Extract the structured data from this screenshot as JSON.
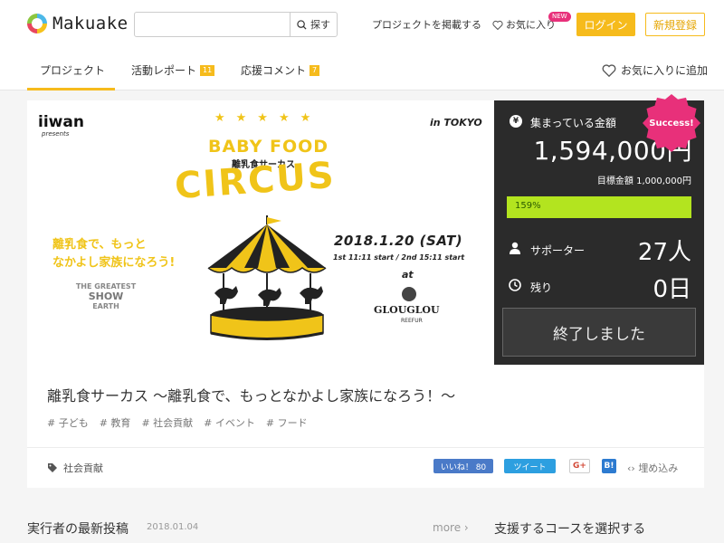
{
  "header": {
    "logo": "Makuake",
    "search_placeholder": "",
    "search_button": "探す",
    "post_project": "プロジェクトを掲載する",
    "favorites": "お気に入り",
    "new_badge": "NEW",
    "login": "ログイン",
    "signup": "新規登録"
  },
  "tabs": [
    {
      "label": "プロジェクト"
    },
    {
      "label": "活動レポート",
      "count": "11"
    },
    {
      "label": "応援コメント",
      "count": "7"
    }
  ],
  "add_favorite": "お気に入りに追加",
  "hero": {
    "brand": "iiwan",
    "brand_sub": "presents",
    "city": "in TOKYO",
    "stars": "★★★★★",
    "baby_food": "BABY FOOD",
    "baby_food_sub": "離乳食サーカス",
    "circus": "CIRCUS",
    "catch_line1": "離乳食で、もっと",
    "catch_line2": "なかよし家族になろう!",
    "greatest_1": "THE GREATEST",
    "greatest_2": "SHOW",
    "greatest_3": "EARTH",
    "date": "2018.1.20 (SAT)",
    "times": "1st 11:11 start / 2nd 15:11 start",
    "at": "at",
    "venue": "GLOUGLOU",
    "venue_sub": "REEFUR"
  },
  "funding": {
    "collected_label": "集まっている金額",
    "amount": "1,594,000円",
    "goal": "目標金額 1,000,000円",
    "progress_text": "159%",
    "progress_fraction": 1.0,
    "supporters_label": "サポーター",
    "supporters_value": "27人",
    "remaining_label": "残り",
    "remaining_value": "0日",
    "finished": "終了しました",
    "success_badge": "Success!"
  },
  "project": {
    "title": "離乳食サーカス ～離乳食で、もっとなかよし家族になろう！～",
    "tags": [
      "# 子ども",
      "# 教育",
      "# 社会貢献",
      "# イベント",
      "# フード"
    ],
    "category": "社会貢献"
  },
  "share": {
    "like": "いいね！ 80",
    "tweet": "ツイート",
    "gplus": "G+",
    "hatena": "B!",
    "embed": "埋め込み"
  },
  "bottom": {
    "latest_post": "実行者の最新投稿",
    "latest_date": "2018.01.04",
    "more": "more ›",
    "select_course": "支援するコースを選択する"
  },
  "colors": {
    "accent": "#f6bb1c",
    "panel": "#2b2b2b",
    "progress": "#b3e41f",
    "success": "#e8307a"
  }
}
